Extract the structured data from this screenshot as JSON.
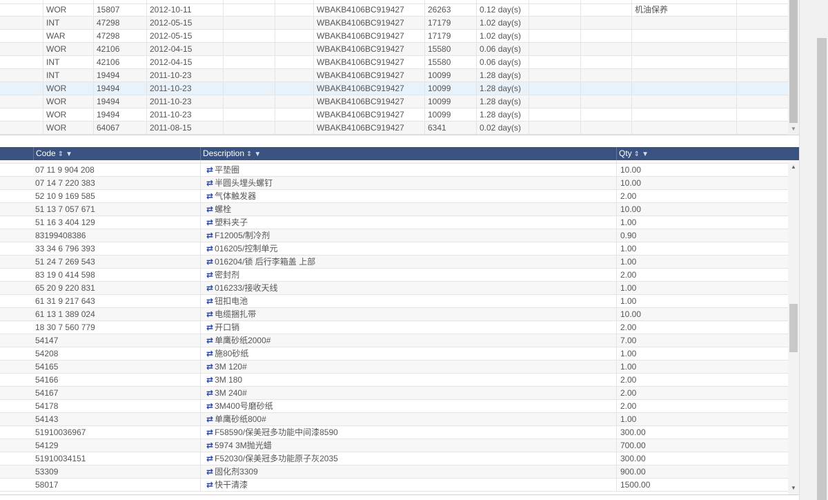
{
  "top_grid": {
    "rows": [
      {
        "type": "WOR",
        "num": "15807",
        "date": "2012-10-11",
        "vin": "WBAKB4106BC919427",
        "km": "26263",
        "dur": "0.12 day(s)",
        "note": "机油保养"
      },
      {
        "type": "INT",
        "num": "47298",
        "date": "2012-05-15",
        "vin": "WBAKB4106BC919427",
        "km": "17179",
        "dur": "1.02 day(s)",
        "note": ""
      },
      {
        "type": "WAR",
        "num": "47298",
        "date": "2012-05-15",
        "vin": "WBAKB4106BC919427",
        "km": "17179",
        "dur": "1.02 day(s)",
        "note": ""
      },
      {
        "type": "WOR",
        "num": "42106",
        "date": "2012-04-15",
        "vin": "WBAKB4106BC919427",
        "km": "15580",
        "dur": "0.06 day(s)",
        "note": ""
      },
      {
        "type": "INT",
        "num": "42106",
        "date": "2012-04-15",
        "vin": "WBAKB4106BC919427",
        "km": "15580",
        "dur": "0.06 day(s)",
        "note": ""
      },
      {
        "type": "INT",
        "num": "19494",
        "date": "2011-10-23",
        "vin": "WBAKB4106BC919427",
        "km": "10099",
        "dur": "1.28 day(s)",
        "note": ""
      },
      {
        "type": "WOR",
        "num": "19494",
        "date": "2011-10-23",
        "vin": "WBAKB4106BC919427",
        "km": "10099",
        "dur": "1.28 day(s)",
        "note": ""
      },
      {
        "type": "WOR",
        "num": "19494",
        "date": "2011-10-23",
        "vin": "WBAKB4106BC919427",
        "km": "10099",
        "dur": "1.28 day(s)",
        "note": ""
      },
      {
        "type": "WOR",
        "num": "19494",
        "date": "2011-10-23",
        "vin": "WBAKB4106BC919427",
        "km": "10099",
        "dur": "1.28 day(s)",
        "note": ""
      },
      {
        "type": "WOR",
        "num": "64067",
        "date": "2011-08-15",
        "vin": "WBAKB4106BC919427",
        "km": "6341",
        "dur": "0.02 day(s)",
        "note": ""
      }
    ],
    "selected_row": 6
  },
  "bottom_grid": {
    "headers": {
      "code": "Code",
      "description": "Description",
      "qty": "Qty"
    },
    "sort_icon": "sort-icon",
    "filter_icon": "filter-icon",
    "link_icon": "⇄",
    "rows": [
      {
        "code": "07 11 9 904 208",
        "desc": "平垫圈",
        "qty": "10.00"
      },
      {
        "code": "07 14 7 220 383",
        "desc": "半圆头埋头螺钉",
        "qty": "10.00"
      },
      {
        "code": "52 10 9 169 585",
        "desc": "气体触发器",
        "qty": "2.00"
      },
      {
        "code": "51 13 7 057 671",
        "desc": "螺栓",
        "qty": "10.00"
      },
      {
        "code": "51 16 3 404 129",
        "desc": "塑料夹子",
        "qty": "1.00"
      },
      {
        "code": "83199408386",
        "desc": "F12005/制冷剂",
        "qty": "0.90"
      },
      {
        "code": "33 34 6 796 393",
        "desc": "016205/控制单元",
        "qty": "1.00"
      },
      {
        "code": "51 24 7 269 543",
        "desc": "016204/锁 后行李箱盖 上部",
        "qty": "1.00"
      },
      {
        "code": "83 19 0 414 598",
        "desc": "密封剂",
        "qty": "2.00"
      },
      {
        "code": "65 20 9 220 831",
        "desc": "016233/接收天线",
        "qty": "1.00"
      },
      {
        "code": "61 31 9 217 643",
        "desc": "钮扣电池",
        "qty": "1.00"
      },
      {
        "code": "61 13 1 389 024",
        "desc": "电缆捆扎带",
        "qty": "10.00"
      },
      {
        "code": "18 30 7 560 779",
        "desc": "开口销",
        "qty": "2.00"
      },
      {
        "code": "54147",
        "desc": "单鹰砂纸2000#",
        "qty": "7.00"
      },
      {
        "code": "54208",
        "desc": "施80砂纸",
        "qty": "1.00"
      },
      {
        "code": "54165",
        "desc": "3M 120#",
        "qty": "1.00"
      },
      {
        "code": "54166",
        "desc": "3M 180",
        "qty": "2.00"
      },
      {
        "code": "54167",
        "desc": "3M 240#",
        "qty": "2.00"
      },
      {
        "code": "54178",
        "desc": "3M400号磨砂纸",
        "qty": "2.00"
      },
      {
        "code": "54143",
        "desc": "单鹰砂纸800#",
        "qty": "1.00"
      },
      {
        "code": "51910036967",
        "desc": "F58590/保美冠多功能中间漆8590",
        "qty": "300.00"
      },
      {
        "code": "54129",
        "desc": "5974 3M抛光蜡",
        "qty": "700.00"
      },
      {
        "code": "51910034151",
        "desc": "F52030/保美冠多功能原子灰2035",
        "qty": "300.00"
      },
      {
        "code": "53309",
        "desc": "固化剂3309",
        "qty": "900.00"
      },
      {
        "code": "58017",
        "desc": "快干清漆",
        "qty": "1500.00"
      }
    ]
  },
  "colors": {
    "header_bg": "#3a5280",
    "selected_row": "#e8f2fb",
    "link_icon": "#2646a8"
  }
}
